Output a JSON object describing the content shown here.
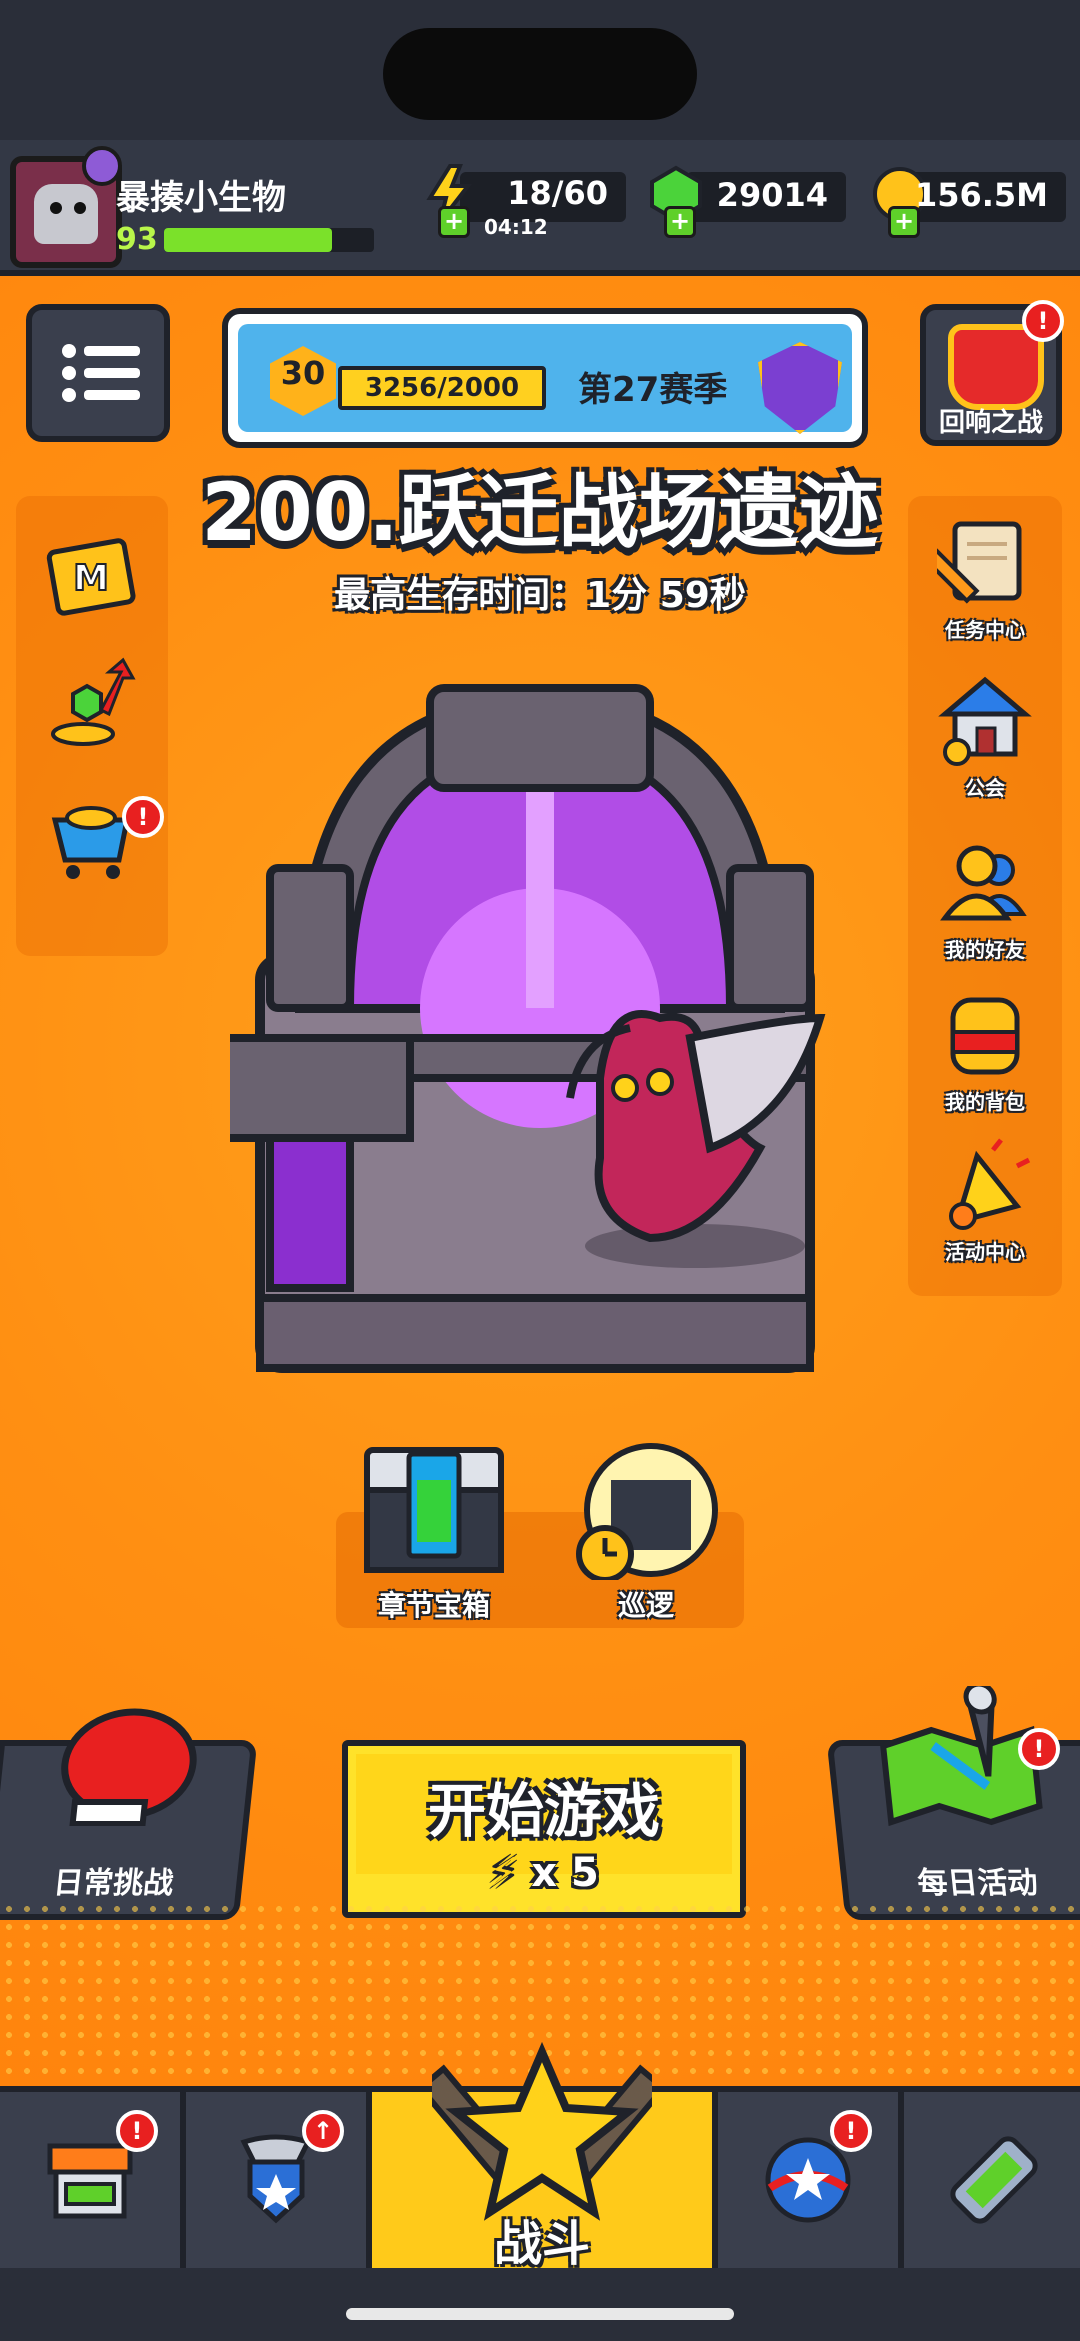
{
  "player": {
    "name": "暴揍小生物",
    "level": "93",
    "xp_progress": 0.8
  },
  "resources": {
    "energy": {
      "value": "18/60",
      "timer": "04:12",
      "icon": "lightning-icon"
    },
    "gems": {
      "value": "29014",
      "icon": "green-gem-icon"
    },
    "coins": {
      "value": "156.5M",
      "icon": "gold-coin-icon"
    }
  },
  "season": {
    "rank": "30",
    "progress": "3256/2000",
    "label": "第27赛季"
  },
  "echo_battle": {
    "label": "回响之战",
    "alert": "!"
  },
  "stage": {
    "title": "200.跃迁战场遗迹",
    "best_time": "最高生存时间：1分 59秒"
  },
  "left_side": {
    "items": [
      {
        "name": "m-card-icon"
      },
      {
        "name": "growth-gems-coins-icon"
      },
      {
        "name": "shop-cart-icon",
        "alert": "!"
      }
    ]
  },
  "right_side": {
    "items": [
      {
        "label": "任务中心",
        "icon": "scroll-pencil-icon"
      },
      {
        "label": "公会",
        "icon": "guild-house-icon"
      },
      {
        "label": "我的好友",
        "icon": "friends-icon"
      },
      {
        "label": "我的背包",
        "icon": "backpack-icon"
      },
      {
        "label": "活动中心",
        "icon": "party-popper-icon"
      }
    ]
  },
  "sub_buttons": [
    {
      "label": "章节宝箱",
      "icon": "chest-icon"
    },
    {
      "label": "巡逻",
      "icon": "patrol-clock-icon"
    }
  ],
  "actions": {
    "daily_challenge": "日常挑战",
    "start_game": "开始游戏",
    "start_cost": "x 5",
    "daily_event": "每日活动",
    "daily_event_alert": "!"
  },
  "tabs": [
    {
      "name": "shop",
      "alert": "!"
    },
    {
      "name": "equipment",
      "alert": "↑"
    },
    {
      "name": "battle",
      "label": "战斗"
    },
    {
      "name": "talent",
      "alert": "!"
    },
    {
      "name": "gene"
    }
  ],
  "colors": {
    "accent": "#ff8f12",
    "dark": "#333845",
    "yellow": "#ffd61a",
    "alert": "#e82020"
  }
}
